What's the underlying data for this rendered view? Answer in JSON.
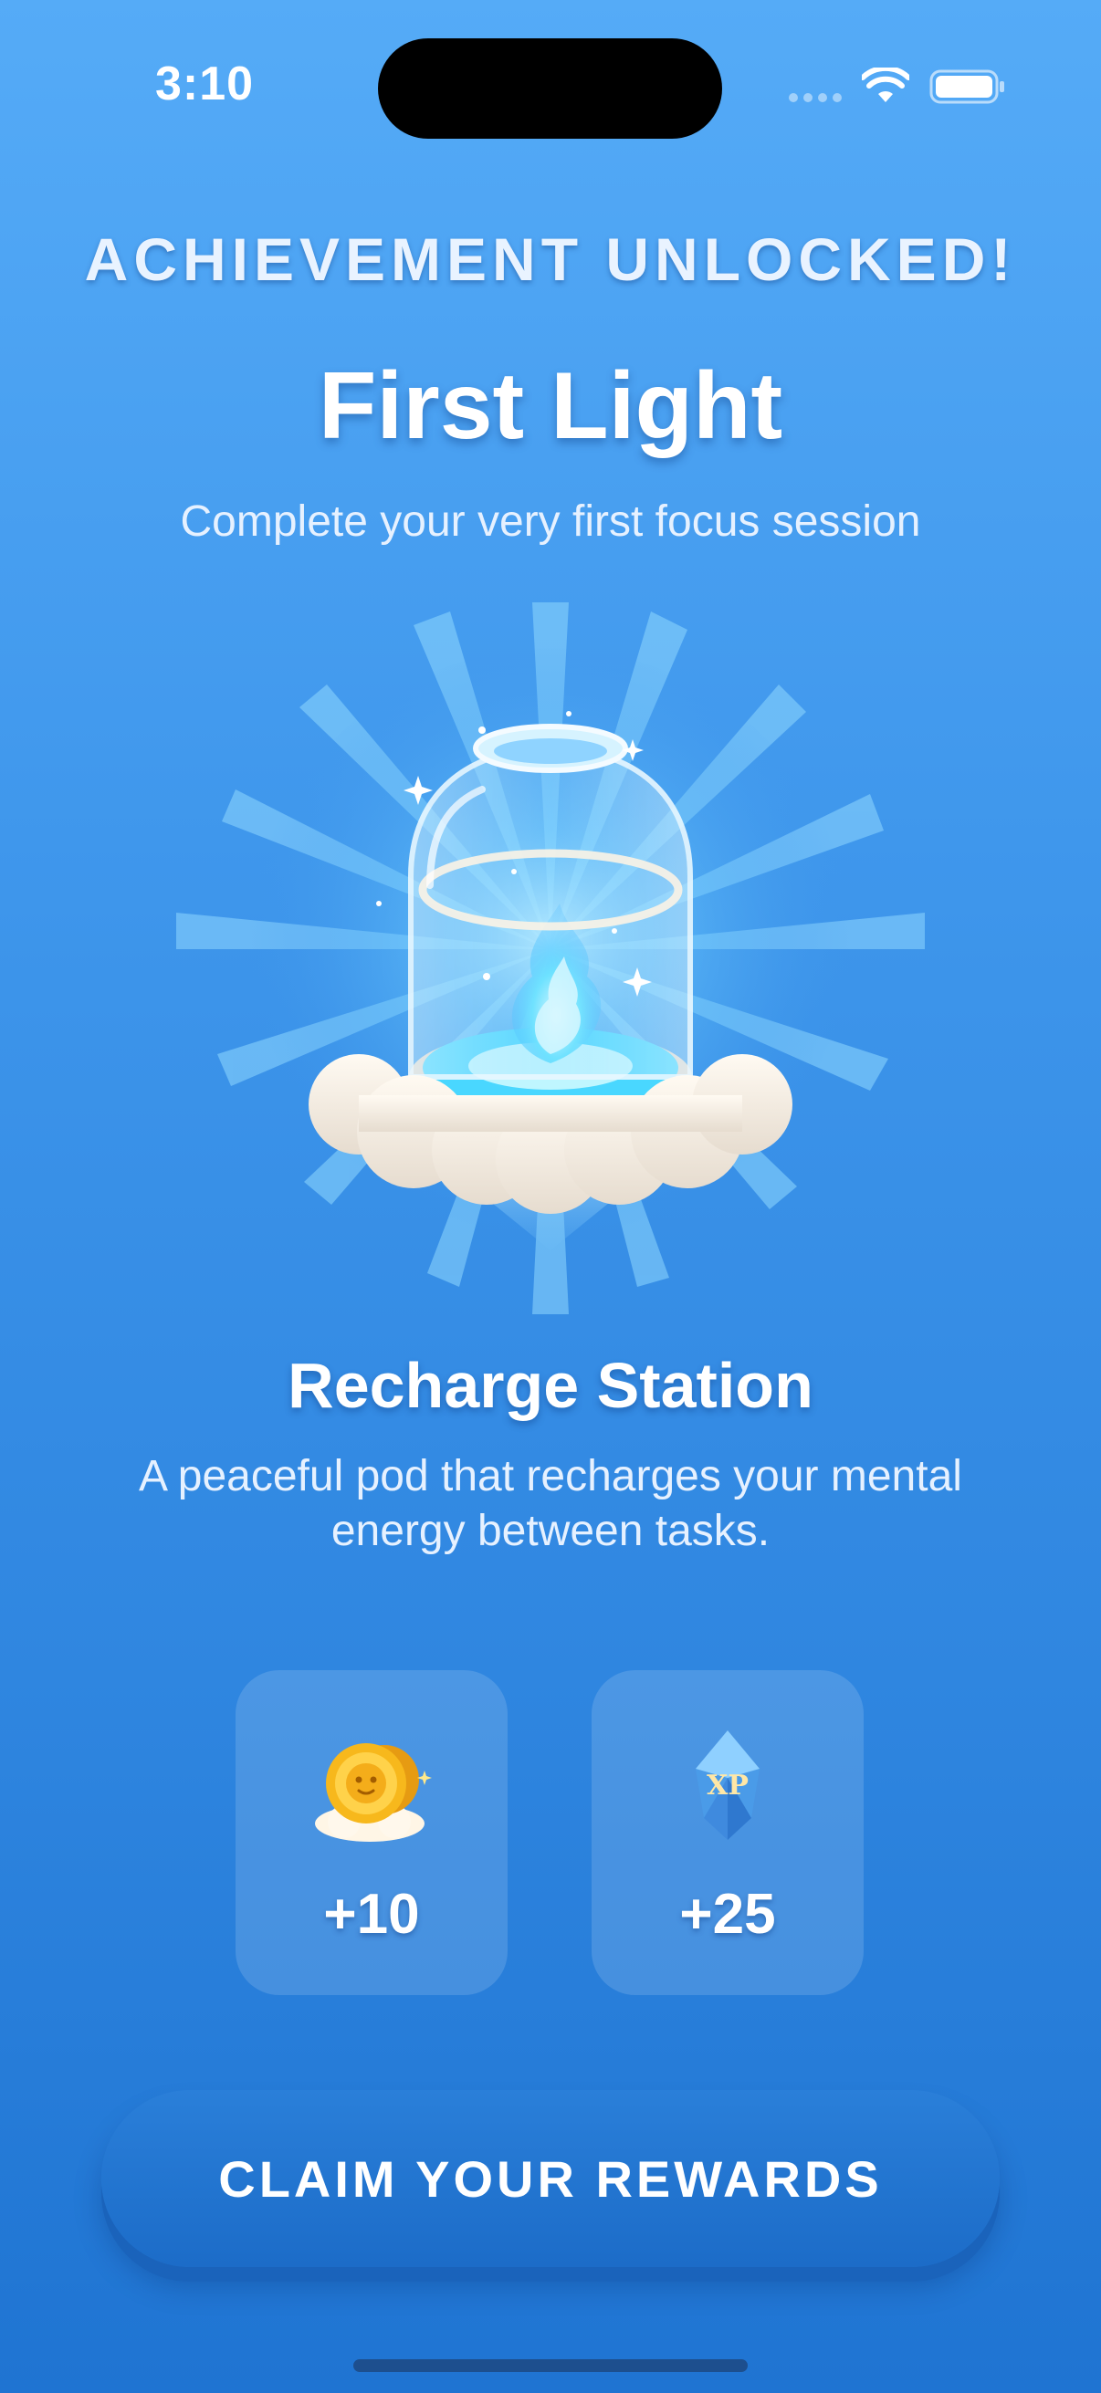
{
  "status_bar": {
    "time": "3:10"
  },
  "achievement": {
    "label": "ACHIEVEMENT UNLOCKED!",
    "title": "First Light",
    "subtitle": "Complete your very first focus session"
  },
  "item": {
    "name": "Recharge Station",
    "description": "A peaceful pod that recharges your mental energy between tasks."
  },
  "rewards": [
    {
      "icon": "gold-coins-icon",
      "value": "+10"
    },
    {
      "icon": "xp-crystal-icon",
      "icon_text": "XP",
      "value": "+25"
    }
  ],
  "claim_button": {
    "label": "CLAIM YOUR REWARDS"
  },
  "colors": {
    "background_top": "#55abf7",
    "background_bottom": "#1f74d2",
    "button": "#1c6cc8",
    "glow": "#4fd6ff"
  }
}
